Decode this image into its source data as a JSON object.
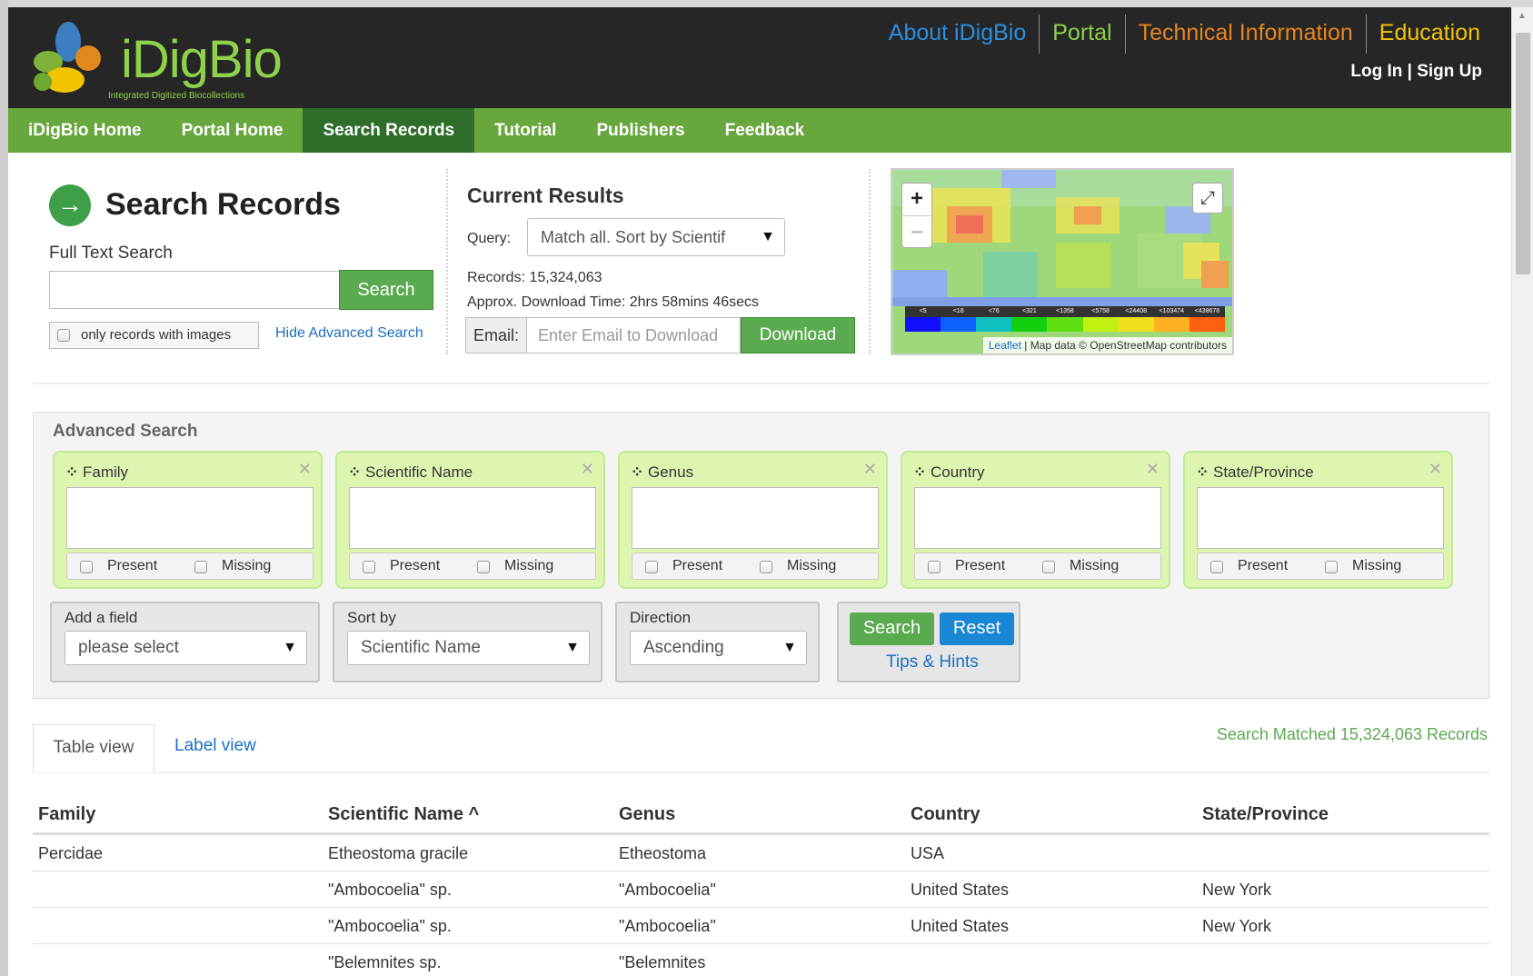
{
  "header": {
    "logo_text": "iDigBio",
    "logo_sub": "Integrated Digitized Biocollections",
    "topnav": [
      {
        "label": "About iDigBio",
        "color": "#2a8fe0"
      },
      {
        "label": "Portal",
        "color": "#8fd24a"
      },
      {
        "label": "Technical Information",
        "color": "#e8851f"
      },
      {
        "label": "Education",
        "color": "#f2c400"
      }
    ],
    "login": "Log In | Sign Up"
  },
  "greennav": [
    "iDigBio Home",
    "Portal Home",
    "Search Records",
    "Tutorial",
    "Publishers",
    "Feedback"
  ],
  "search": {
    "title": "Search Records",
    "fts_label": "Full Text Search",
    "fts_button": "Search",
    "images_only": "only records with images",
    "hide_advanced": "Hide Advanced Search"
  },
  "results": {
    "title": "Current Results",
    "query_label": "Query:",
    "query_value": "Match all. Sort by Scientif",
    "records_line": "Records:  15,324,063",
    "download_time": "Approx. Download Time: 2hrs  58mins  46secs",
    "email_label": "Email:",
    "email_placeholder": "Enter Email to Download",
    "download_button": "Download"
  },
  "map": {
    "zoom_in": "+",
    "zoom_out": "–",
    "legend_labels": [
      "<5",
      "<18",
      "<76",
      "<321",
      "<1358",
      "<5758",
      "<24408",
      "<103474",
      "<438678"
    ],
    "legend_colors": [
      "#1010ff",
      "#1060ff",
      "#10c0c0",
      "#10d010",
      "#60e010",
      "#c0f010",
      "#f0e020",
      "#ffb020",
      "#ff6010"
    ],
    "attribution_link": "Leaflet",
    "attribution_text": "| Map data © OpenStreetMap contributors"
  },
  "advanced": {
    "title": "Advanced Search",
    "fields": [
      "Family",
      "Scientific Name",
      "Genus",
      "Country",
      "State/Province"
    ],
    "present": "Present",
    "missing": "Missing",
    "add_field_label": "Add a field",
    "add_field_value": "please select",
    "sort_label": "Sort by",
    "sort_value": "Scientific Name",
    "direction_label": "Direction",
    "direction_value": "Ascending",
    "search_button": "Search",
    "reset_button": "Reset",
    "tips": "Tips & Hints"
  },
  "tabs": {
    "table": "Table view",
    "label": "Label view",
    "matched": "Search Matched 15,324,063 Records"
  },
  "table": {
    "columns": [
      "Family",
      "Scientific Name",
      "Genus",
      "Country",
      "State/Province"
    ],
    "sort_indicator": "^",
    "rows": [
      [
        "Percidae",
        "Etheostoma gracile",
        "Etheostoma",
        "USA",
        ""
      ],
      [
        "",
        "\"Ambocoelia\" sp.",
        "\"Ambocoelia\"",
        "United States",
        "New York"
      ],
      [
        "",
        "\"Ambocoelia\" sp.",
        "\"Ambocoelia\"",
        "United States",
        "New York"
      ],
      [
        "",
        "\"Belemnites sp.",
        "\"Belemnites",
        "",
        ""
      ]
    ]
  }
}
